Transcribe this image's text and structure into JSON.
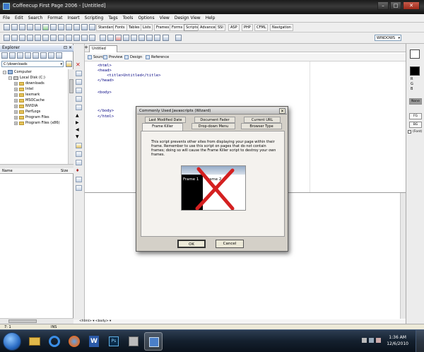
{
  "window": {
    "title": "Coffeecup First Page 2006 - [Untitled]"
  },
  "menu": [
    "File",
    "Edit",
    "Search",
    "Format",
    "Insert",
    "Scripting",
    "Tags",
    "Tools",
    "Options",
    "View",
    "Design View",
    "Help"
  ],
  "tag_tabs": [
    "Standard",
    "Fonts",
    "Tables",
    "Lists",
    "Frames",
    "Forms",
    "Scripts",
    "Advanced",
    "SSI",
    "ASP",
    "PHP",
    "CFML",
    "Navigation"
  ],
  "active_tag_tab": "Scripts",
  "doctype_select": "WINDOWS",
  "explorer": {
    "header": "Explorer",
    "path": "C:\\downloads",
    "tree": [
      {
        "label": "Computer",
        "level": 0,
        "type": "computer"
      },
      {
        "label": "Local Disk (C:)",
        "level": 1,
        "type": "drive"
      },
      {
        "label": "downloads",
        "level": 2,
        "type": "folder"
      },
      {
        "label": "Intel",
        "level": 2,
        "type": "folder"
      },
      {
        "label": "lexmark",
        "level": 2,
        "type": "folder"
      },
      {
        "label": "MSOCache",
        "level": 2,
        "type": "folder"
      },
      {
        "label": "NVIDIA",
        "level": 2,
        "type": "folder"
      },
      {
        "label": "PerfLogs",
        "level": 2,
        "type": "folder"
      },
      {
        "label": "Program Files",
        "level": 2,
        "type": "folder"
      },
      {
        "label": "Program Files (x86)",
        "level": 2,
        "type": "folder"
      }
    ],
    "file_cols": [
      "Name",
      "Size"
    ]
  },
  "editor": {
    "doc_tab": "Untitled",
    "modes": [
      "Source",
      "Preview",
      "Design",
      "Reference"
    ],
    "code_lines": [
      "<html>",
      "<head>",
      "    <title>Untitled</title>",
      "</head>",
      "",
      "<body>",
      "",
      "",
      "",
      "</body>",
      "</html>"
    ],
    "tag_path": "<html> ▾  <body> ▾"
  },
  "right_panel": {
    "fg_label": "FG",
    "bg_label": "BG",
    "font_label": "(Font)",
    "none_label": "None",
    "rgb": [
      "R",
      "G",
      "B"
    ]
  },
  "status": {
    "position": "7:  1",
    "mode": "INS"
  },
  "dialog": {
    "title": "Commonly Used Javascripts (Wizard)",
    "tabs_row1": [
      "Last Modified Date",
      "Document Fader",
      "Current URL"
    ],
    "tabs_row2": [
      "Frame Killer",
      "Drop-down Menu",
      "Browser Type"
    ],
    "active_tab": "Frame Killer",
    "description": "This script prevents other sites from displaying your page within their frame. Remember to use this script on pages that do not contain frames; doing so will cause the Frame Killer script to destroy your own frames.",
    "preview": {
      "frame1": "Frame 1",
      "frame2": "Frame 2"
    },
    "ok": "OK",
    "cancel": "Cancel"
  },
  "taskbar": {
    "time": "1:36 AM",
    "date": "12/6/2010"
  }
}
